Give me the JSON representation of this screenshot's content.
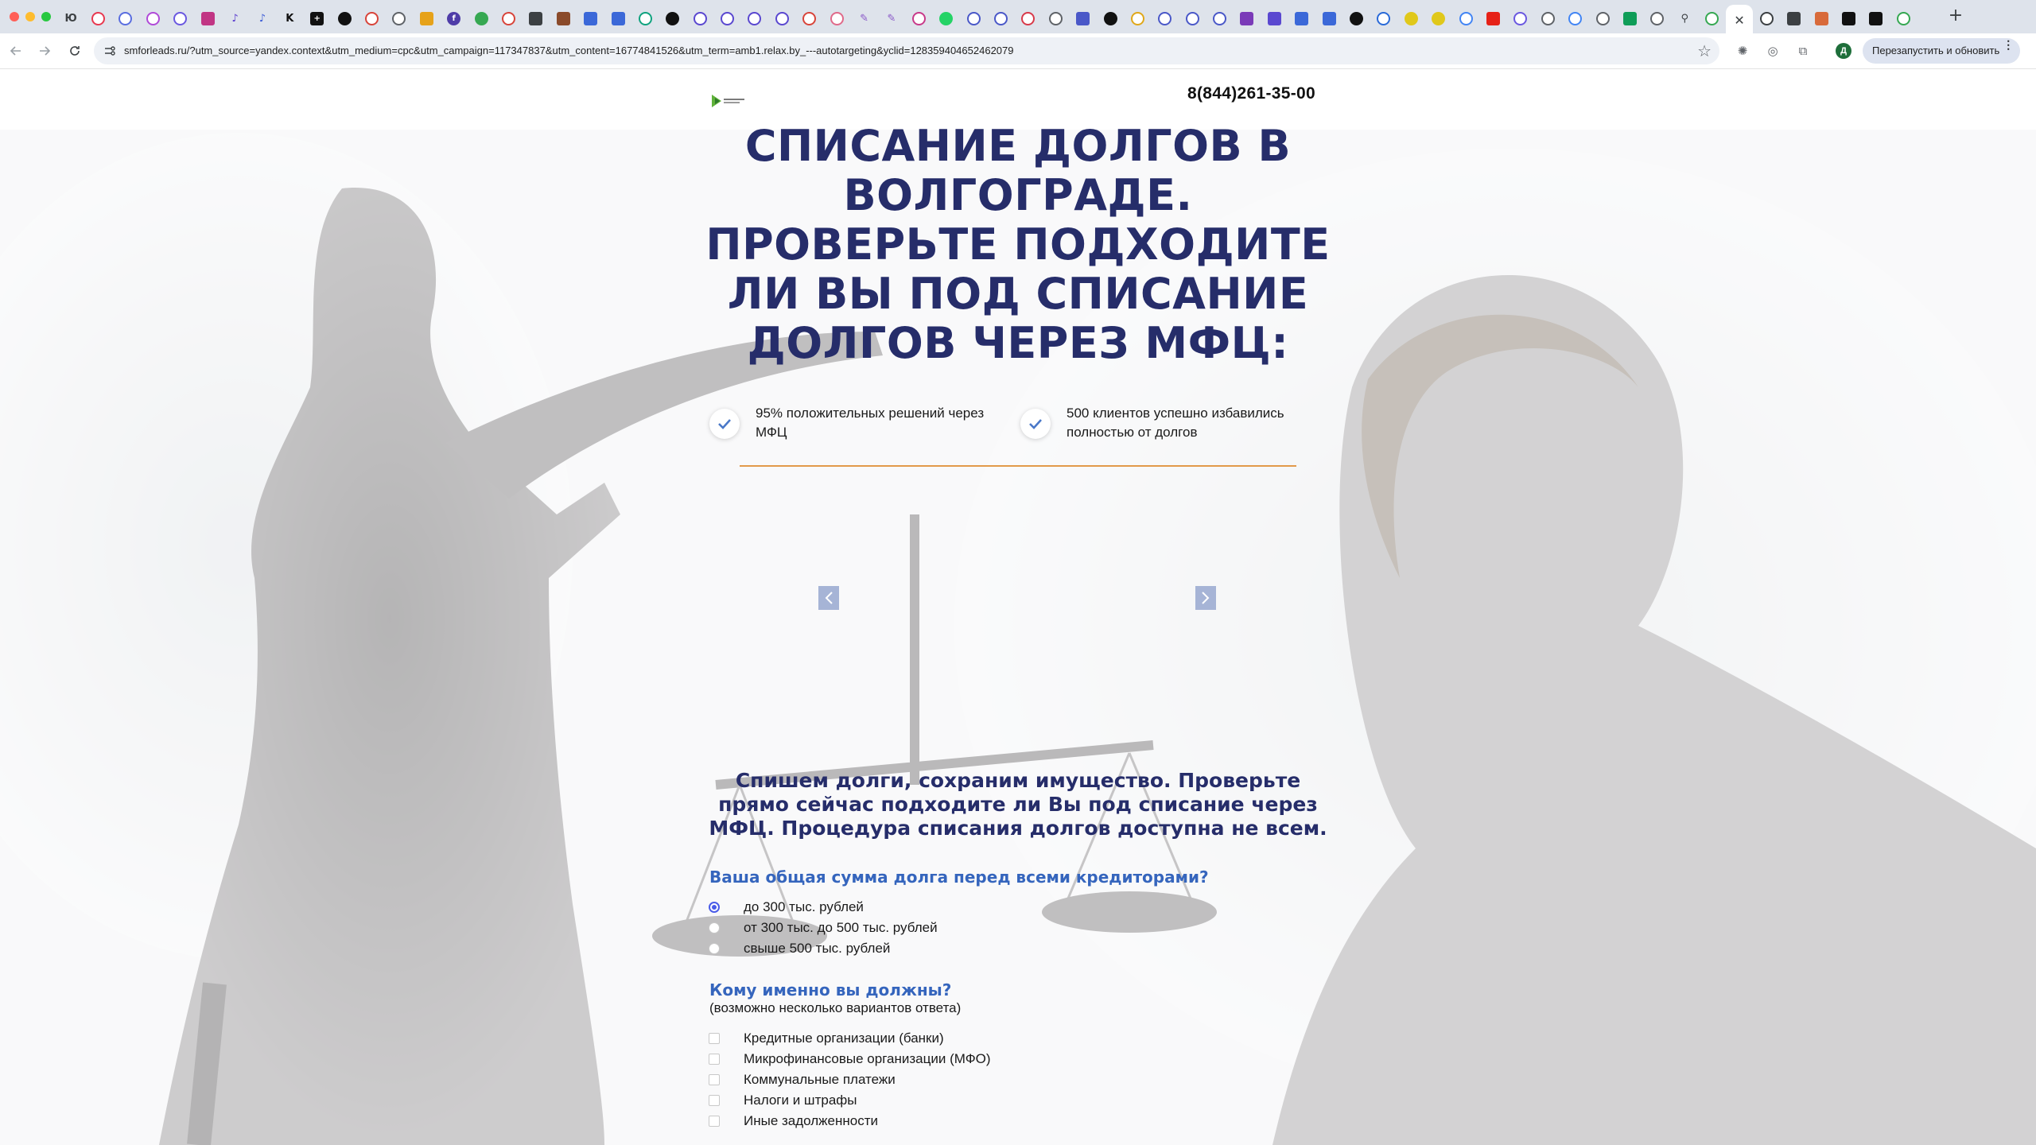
{
  "browser": {
    "tabs": [
      {
        "icon": "yandex-ya-icon",
        "letter": "Ю",
        "color": "#3c4043",
        "shape": "text"
      },
      {
        "icon": "mail-circle-icon",
        "color": "#e8384f",
        "shape": "ring"
      },
      {
        "icon": "chat-circle-icon",
        "color": "#5a6ee0",
        "shape": "ring"
      },
      {
        "icon": "chat-circle-icon",
        "color": "#b04ad8",
        "shape": "ring"
      },
      {
        "icon": "chat-circle-icon",
        "color": "#6a58e0",
        "shape": "ring"
      },
      {
        "icon": "instagram-icon",
        "color": "#c13584",
        "shape": "sq"
      },
      {
        "icon": "tiktok-icon",
        "color": "#5a3ccf",
        "shape": "text",
        "letter": "♪"
      },
      {
        "icon": "tiktok-icon",
        "color": "#3b5bd6",
        "shape": "text",
        "letter": "♪"
      },
      {
        "icon": "kwork-icon",
        "color": "#111111",
        "shape": "text",
        "letter": "K"
      },
      {
        "icon": "plus-square-icon",
        "color": "#111111",
        "shape": "sq",
        "letter": "+"
      },
      {
        "icon": "circle-app-icon",
        "color": "#111111",
        "shape": "dot"
      },
      {
        "icon": "globe-red-icon",
        "color": "#d8443a",
        "shape": "ring"
      },
      {
        "icon": "gear-circle-icon",
        "color": "#5f6368",
        "shape": "ring"
      },
      {
        "icon": "envelope-icon",
        "color": "#e6a21a",
        "shape": "sq"
      },
      {
        "icon": "facebook-icon",
        "color": "#4e3ca8",
        "shape": "dot",
        "letter": "f"
      },
      {
        "icon": "puzzle-icon",
        "color": "#36a852",
        "shape": "dot"
      },
      {
        "icon": "globe-red-icon",
        "color": "#d8443a",
        "shape": "ring"
      },
      {
        "icon": "book-icon",
        "color": "#3c4043",
        "shape": "sq"
      },
      {
        "icon": "image-icon",
        "color": "#8a4a2a",
        "shape": "sq"
      },
      {
        "icon": "chat-square-icon",
        "color": "#3b68d8",
        "shape": "sq"
      },
      {
        "icon": "chat-square-icon",
        "color": "#3b68d8",
        "shape": "sq"
      },
      {
        "icon": "openai-icon",
        "color": "#10a37f",
        "shape": "ring"
      },
      {
        "icon": "circle-app-icon",
        "color": "#111111",
        "shape": "dot"
      },
      {
        "icon": "forward-circle-icon",
        "color": "#5a48d0",
        "shape": "ring"
      },
      {
        "icon": "forward-circle-icon",
        "color": "#5a48d0",
        "shape": "ring"
      },
      {
        "icon": "forward-circle-icon",
        "color": "#5a48d0",
        "shape": "ring"
      },
      {
        "icon": "pinterest-icon",
        "color": "#5a48d0",
        "shape": "ring"
      },
      {
        "icon": "cancel-circle-icon",
        "color": "#d8443a",
        "shape": "ring"
      },
      {
        "icon": "chat-circle-icon",
        "color": "#e06a8a",
        "shape": "ring"
      },
      {
        "icon": "feather-icon",
        "color": "#8a58c8",
        "shape": "text",
        "letter": "✎"
      },
      {
        "icon": "feather-icon",
        "color": "#8a58c8",
        "shape": "text",
        "letter": "✎"
      },
      {
        "icon": "chat-circle-icon",
        "color": "#c83a8a",
        "shape": "ring"
      },
      {
        "icon": "whatsapp-icon",
        "color": "#25d366",
        "shape": "dot"
      },
      {
        "icon": "person-circle-icon",
        "color": "#4a58c8",
        "shape": "ring"
      },
      {
        "icon": "person-circle-icon",
        "color": "#4a58c8",
        "shape": "ring"
      },
      {
        "icon": "heart-icon",
        "color": "#d83a4a",
        "shape": "ring"
      },
      {
        "icon": "gear-circle-icon",
        "color": "#5f6368",
        "shape": "ring"
      },
      {
        "icon": "document-icon",
        "color": "#4a58c8",
        "shape": "sq"
      },
      {
        "icon": "circle-app-icon",
        "color": "#111111",
        "shape": "dot"
      },
      {
        "icon": "cycle-icon",
        "color": "#e0a81a",
        "shape": "ring"
      },
      {
        "icon": "cycle-icon",
        "color": "#4a58c8",
        "shape": "ring"
      },
      {
        "icon": "cycle-icon",
        "color": "#4a58c8",
        "shape": "ring"
      },
      {
        "icon": "cycle-icon",
        "color": "#4a58c8",
        "shape": "ring"
      },
      {
        "icon": "square-app-icon",
        "color": "#7a3ab8",
        "shape": "sq"
      },
      {
        "icon": "square-app-icon",
        "color": "#5a48d0",
        "shape": "sq"
      },
      {
        "icon": "square-app-icon",
        "color": "#3b68d8",
        "shape": "sq"
      },
      {
        "icon": "square-app-icon",
        "color": "#3b68d8",
        "shape": "sq"
      },
      {
        "icon": "github-icon",
        "color": "#111111",
        "shape": "dot"
      },
      {
        "icon": "globe-blue-icon",
        "color": "#2a6ad8",
        "shape": "ring"
      },
      {
        "icon": "bolt-icon",
        "color": "#e0c81a",
        "shape": "dot"
      },
      {
        "icon": "bolt-icon",
        "color": "#e0c81a",
        "shape": "dot"
      },
      {
        "icon": "google-icon",
        "color": "#4285f4",
        "shape": "ring"
      },
      {
        "icon": "youtube-icon",
        "color": "#e62117",
        "shape": "sq"
      },
      {
        "icon": "chat-circle-icon",
        "color": "#6a58e0",
        "shape": "ring"
      },
      {
        "icon": "gear-circle-icon",
        "color": "#5f6368",
        "shape": "ring"
      },
      {
        "icon": "google-icon",
        "color": "#4285f4",
        "shape": "ring"
      },
      {
        "icon": "google-icon",
        "color": "#5f6368",
        "shape": "ring"
      },
      {
        "icon": "sheets-icon",
        "color": "#0f9d58",
        "shape": "sq"
      },
      {
        "icon": "gear-circle-icon",
        "color": "#5f6368",
        "shape": "ring"
      },
      {
        "icon": "link-icon",
        "color": "#3c4043",
        "shape": "text",
        "letter": "⚲"
      },
      {
        "icon": "swirl-icon",
        "color": "#36a852",
        "shape": "ring"
      },
      {
        "icon": "close-icon",
        "color": "#3c4043",
        "shape": "close",
        "active": true
      },
      {
        "icon": "help-circle-icon",
        "color": "#3c4043",
        "shape": "ring"
      },
      {
        "icon": "grid-icon",
        "color": "#3c4043",
        "shape": "sq"
      },
      {
        "icon": "shield-icon",
        "color": "#d86a3a",
        "shape": "sq"
      },
      {
        "icon": "bars-icon",
        "color": "#111111",
        "shape": "sq"
      },
      {
        "icon": "black-square-icon",
        "color": "#111111",
        "shape": "sq"
      },
      {
        "icon": "swirl-icon",
        "color": "#36a852",
        "shape": "ring"
      }
    ],
    "new_tab_label": "+",
    "url": "smforleads.ru/?utm_source=yandex.context&utm_medium=cpc&utm_campaign=117347837&utm_content=16774841526&utm_term=amb1.relax.by_---autotargeting&yclid=12835940465246207­9",
    "relaunch_label": "Перезапустить и обновить",
    "profile_letter": "Д"
  },
  "site": {
    "phone": "8(844)261-35-00",
    "headline": "Списание долгов в Волгограде. Проверьте подходите ли Вы под списание долгов через МФЦ:",
    "features": [
      {
        "text": "95% положительных решений через МФЦ"
      },
      {
        "text": "500 клиентов успешно избавились полностью от долгов"
      }
    ],
    "subheadline": "Спишем долги, сохраним имущество. Проверьте прямо сейчас подходите ли Вы под списание через МФЦ. Процедура списания долгов доступна не всем.",
    "question1": {
      "title": "Ваша общая сумма долга перед всеми кредиторами?",
      "options": [
        {
          "label": "до 300 тыс. рублей",
          "selected": true
        },
        {
          "label": "от 300 тыс. до 500 тыс. рублей",
          "selected": false
        },
        {
          "label": "свыше 500 тыс. рублей",
          "selected": false
        }
      ]
    },
    "question2": {
      "title": "Кому именно вы должны?",
      "hint": "(возможно несколько вариантов ответа)",
      "options": [
        {
          "label": "Кредитные организации (банки)",
          "checked": false
        },
        {
          "label": "Микрофинансовые организации (МФО)",
          "checked": false
        },
        {
          "label": "Коммунальные платежи",
          "checked": false
        },
        {
          "label": "Налоги и штрафы",
          "checked": false
        },
        {
          "label": "Иные задолженности",
          "checked": false
        }
      ]
    },
    "colors": {
      "headline": "#262d6a",
      "question": "#3565bd",
      "divider": "#e29a4a",
      "check": "#4a78c8"
    }
  }
}
